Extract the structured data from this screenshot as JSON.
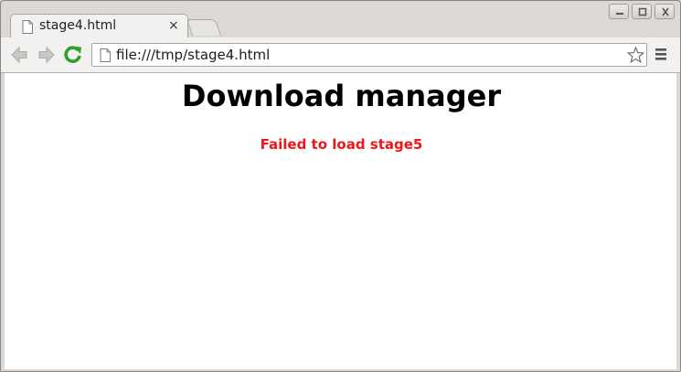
{
  "browser": {
    "tab": {
      "title": "stage4.html",
      "close_glyph": "×",
      "icon": "page-icon"
    },
    "toolbar": {
      "url": "file:///tmp/stage4.html",
      "back_icon": "back-arrow-icon",
      "forward_icon": "forward-arrow-icon",
      "reload_icon": "reload-icon",
      "bookmark_icon": "star-icon",
      "menu_icon": "menu-icon",
      "reload_color": "#2f9e2f"
    },
    "window_controls": [
      "minimize-icon",
      "maximize-icon",
      "close-icon"
    ]
  },
  "page": {
    "heading": "Download manager",
    "error_message": "Failed to load stage5",
    "error_color": "#ef1616"
  }
}
